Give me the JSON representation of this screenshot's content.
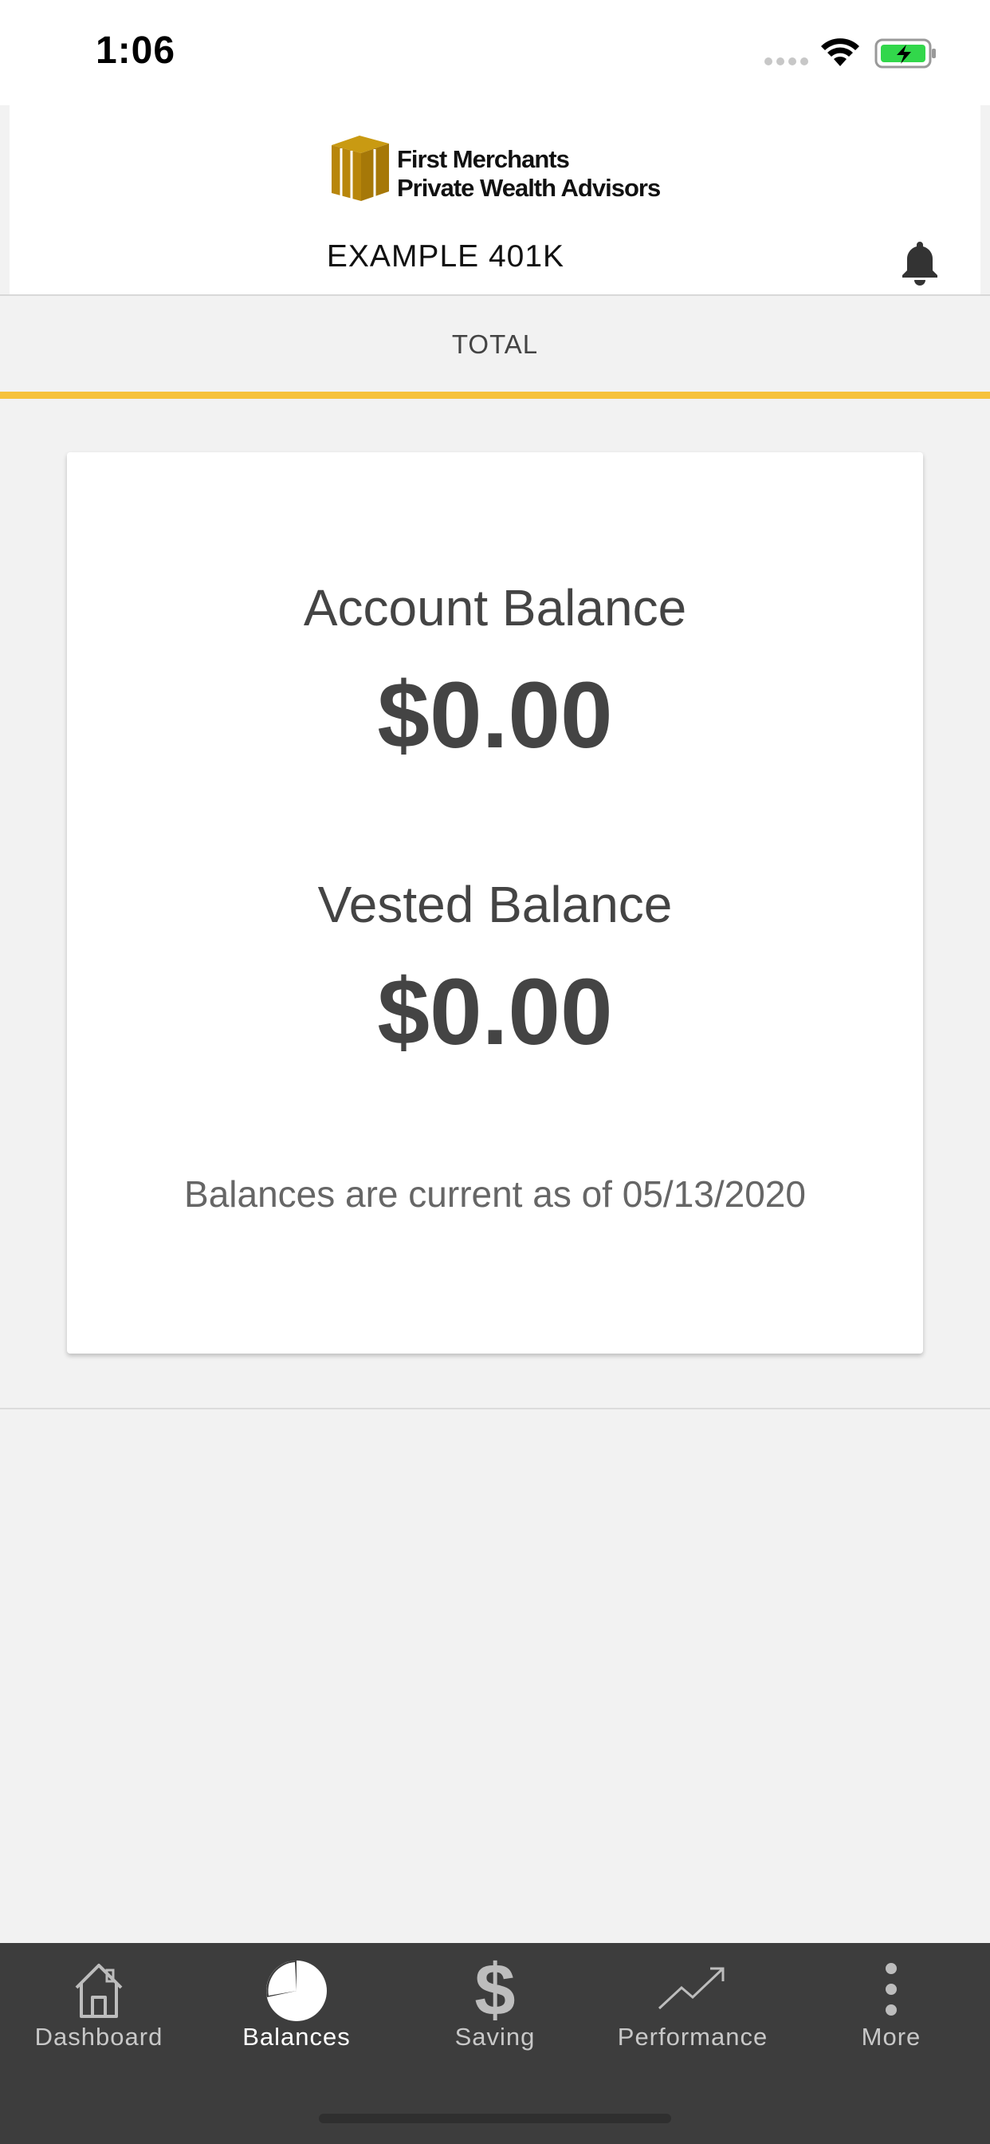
{
  "status_bar": {
    "time": "1:06",
    "icons": [
      "signal-dots-icon",
      "wifi-icon",
      "battery-charging-icon"
    ],
    "battery_color": "#32d74b"
  },
  "header": {
    "logo_line1": "First Merchants",
    "logo_line2": "Private Wealth Advisors",
    "logo_color": "#b8860b",
    "account_name": "EXAMPLE 401K",
    "notification_icon": "bell-icon"
  },
  "tabs": {
    "active_label": "TOTAL",
    "accent_color": "#f6c23c"
  },
  "balances": {
    "account_label": "Account Balance",
    "account_value": "$0.00",
    "vested_label": "Vested Balance",
    "vested_value": "$0.00",
    "as_of_note": "Balances are current as of 05/13/2020"
  },
  "bottom_nav": {
    "items": [
      {
        "label": "Dashboard",
        "icon": "home-icon"
      },
      {
        "label": "Balances",
        "icon": "pie-chart-icon"
      },
      {
        "label": "Saving",
        "icon": "dollar-icon"
      },
      {
        "label": "Performance",
        "icon": "trend-up-icon"
      },
      {
        "label": "More",
        "icon": "more-vertical-icon"
      }
    ],
    "active_index": 1
  }
}
